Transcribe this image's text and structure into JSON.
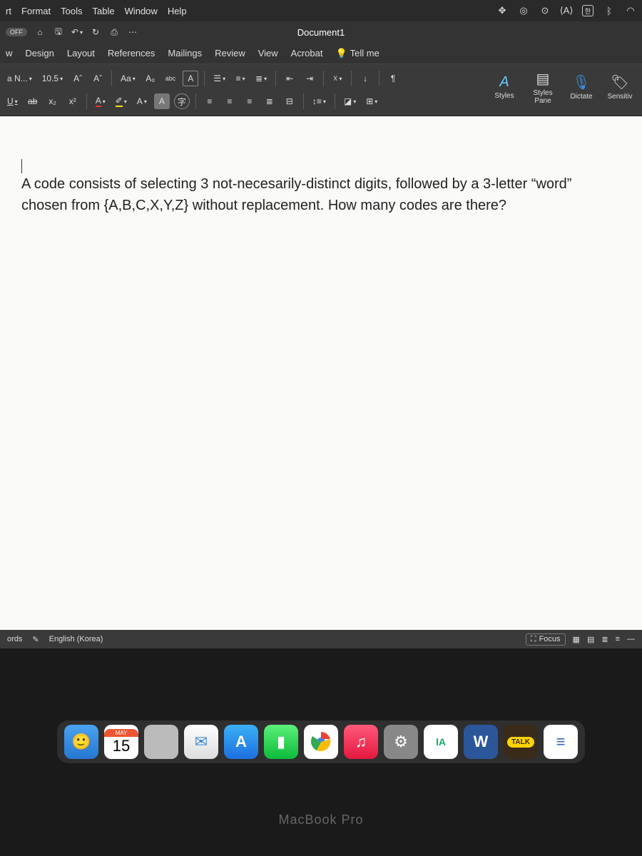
{
  "mac_menu": {
    "items": [
      "rt",
      "Format",
      "Tools",
      "Table",
      "Window",
      "Help"
    ],
    "right_icons": [
      "dropbox",
      "spiral",
      "record",
      "input",
      "korean",
      "bluetooth",
      "wifi"
    ]
  },
  "qat": {
    "off_label": "OFF",
    "doc_title": "Document1"
  },
  "ribbon_tabs": [
    "w",
    "Design",
    "Layout",
    "References",
    "Mailings",
    "Review",
    "View",
    "Acrobat"
  ],
  "tell_me": "Tell me",
  "ribbon": {
    "font_name": "a N...",
    "font_size": "10.5",
    "grow_font": "Aˆ",
    "shrink_font": "Aˇ",
    "change_case": "Aa",
    "clear_format": "A₀",
    "phonetic": "abc",
    "char_border": "A",
    "underline": "U",
    "strike": "ab",
    "subscript": "x₂",
    "superscript": "x²",
    "font_color": "A",
    "highlight": "✐",
    "text_effects": "A",
    "char_shading": "A",
    "enclose": "字",
    "sort": "↓",
    "pilcrow": "¶",
    "styles_label": "Styles",
    "styles_pane_label": "Styles\nPane",
    "dictate_label": "Dictate",
    "sensitivity_label": "Sensitiv"
  },
  "document": {
    "body": "A code consists of selecting 3 not-necesarily-distinct digits, followed by a 3-letter “word” chosen from {A,B,C,X,Y,Z} without replacement. How many codes are there?"
  },
  "status": {
    "words": "ords",
    "language": "English (Korea)",
    "focus": "Focus"
  },
  "dock": {
    "cal_month": "MAY",
    "cal_day": "15",
    "word_letter": "W",
    "talk_label": "TALK",
    "la_label": "lA"
  },
  "laptop": "MacBook Pro"
}
